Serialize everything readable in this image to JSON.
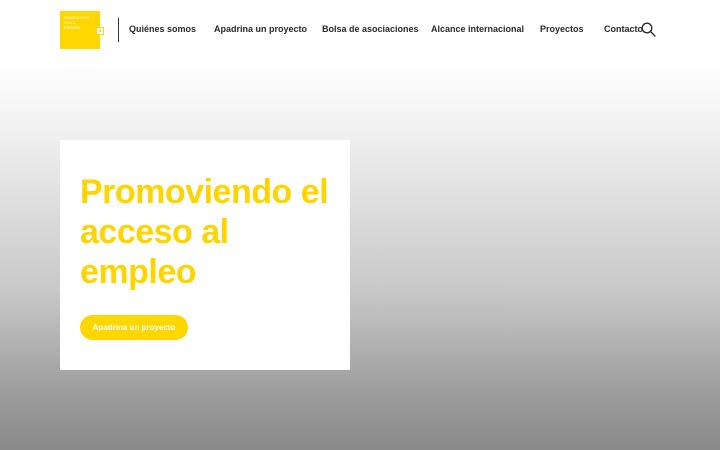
{
  "logo": {
    "lines": [
      "FUNDACIÓN",
      "VINCI",
      "ESPAÑA"
    ]
  },
  "nav": {
    "items": [
      {
        "label": "Quiénes somos"
      },
      {
        "label": "Apadrina un proyecto"
      },
      {
        "label": "Bolsa de asociaciones"
      },
      {
        "label": "Alcance internacional"
      },
      {
        "label": "Proyectos"
      },
      {
        "label": "Contacto"
      }
    ],
    "search_icon": "search-icon"
  },
  "hero": {
    "title": "Promoviendo el acceso al empleo",
    "cta_label": "Apadrina un proyecto"
  },
  "colors": {
    "brand_yellow": "#ffd700",
    "text_dark": "#2a2a2a"
  }
}
